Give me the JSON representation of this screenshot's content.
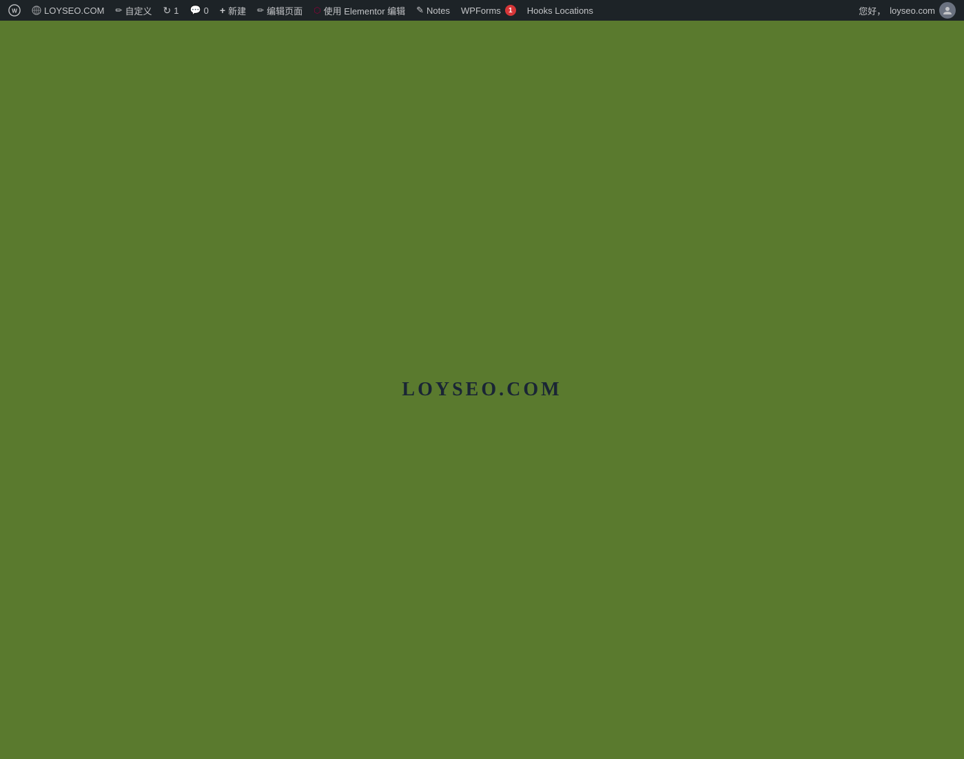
{
  "adminbar": {
    "wp_logo": "WP",
    "site_name": "LOYSEO.COM",
    "customize_label": "自定义",
    "updates_label": "1",
    "updates_count": "1",
    "comments_label": "0",
    "comments_count": "0",
    "new_label": "新建",
    "edit_page_label": "编辑页面",
    "elementor_label": "使用 Elementor 编辑",
    "notes_label": "Notes",
    "wpforms_label": "WPForms",
    "wpforms_badge": "1",
    "hooks_label": "Hooks Locations",
    "greeting": "您好，",
    "username": "loyseo.com"
  },
  "main": {
    "site_title": "LOYSEO.COM",
    "bg_color": "#5a7a2e"
  },
  "icons": {
    "wp": "⊕",
    "customize": "✏",
    "updates": "↻",
    "comments": "✉",
    "new": "+",
    "edit": "✏",
    "elementor": "⬡",
    "notes": "✎",
    "user": "👤"
  }
}
